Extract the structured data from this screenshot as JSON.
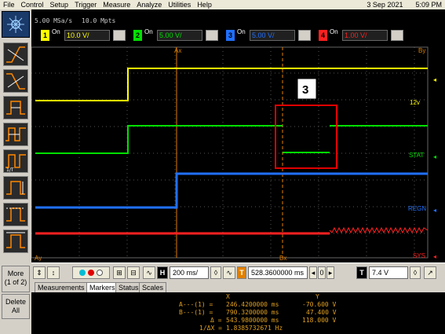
{
  "menu": [
    "File",
    "Control",
    "Setup",
    "Trigger",
    "Measure",
    "Analyze",
    "Utilities",
    "Help"
  ],
  "datetime": {
    "date": "3 Sep 2021",
    "time": "5:09 PM"
  },
  "acquisition": {
    "sample_rate": "5.00 MSa/s",
    "memory": "10.0 Mpts"
  },
  "channels": [
    {
      "number": "1",
      "on_label": "On",
      "value": "10.0 V/",
      "color": "#ffff00"
    },
    {
      "number": "2",
      "on_label": "On",
      "value": "5.00 V/",
      "color": "#00e000"
    },
    {
      "number": "3",
      "on_label": "On",
      "value": "5.00 V/",
      "color": "#2070ff"
    },
    {
      "number": "4",
      "on_label": "On",
      "value": "1.00 V/",
      "color": "#ff2020"
    }
  ],
  "graticule": {
    "marker_labels": {
      "ax_top": "Ax",
      "by_top": "By",
      "ax_bottom": "Ay",
      "bx_bottom": "Bx"
    },
    "trace_labels": {
      "ch1": "12v",
      "ch2": "STAT",
      "ch3": "REGN",
      "ch4": "SYS"
    },
    "annotation": "3"
  },
  "sidebar": {
    "more_label": "More",
    "more_page": "(1 of 2)",
    "delete_label": "Delete",
    "delete_sub": "All"
  },
  "controls": {
    "timebase": "200 ms/",
    "delay": "528.3600000 ms",
    "trigger_level": "7.4 V",
    "h_label": "H",
    "t_label": "T"
  },
  "tabs": [
    "Measurements",
    "Markers",
    "Status",
    "Scales"
  ],
  "markers": {
    "header_x": "X",
    "header_y": "Y",
    "rows": [
      {
        "label": "A---(1) =",
        "x": "246.4200000 ms",
        "y": "-70.600 V"
      },
      {
        "label": "B---(1) =",
        "x": "790.3200000 ms",
        "y": "47.400 V"
      },
      {
        "label": "Δ =",
        "x": "543.9800000 ms",
        "y": "118.000 V"
      },
      {
        "label": "1/ΔX =",
        "x": "1.8385732671 Hz",
        "y": ""
      }
    ]
  }
}
